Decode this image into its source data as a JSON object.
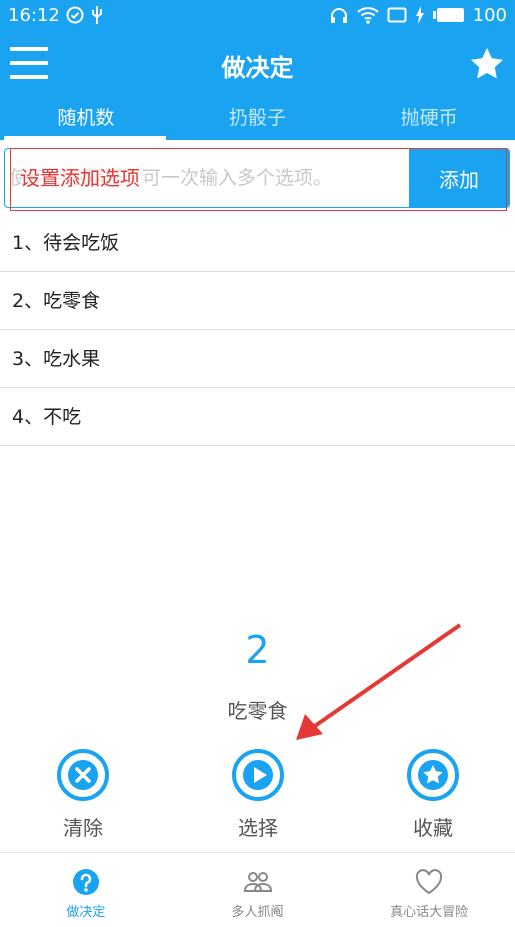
{
  "colors": {
    "accent": "#1aa3f0",
    "annotation": "#e53935"
  },
  "status_bar": {
    "time": "16:12",
    "battery": "100"
  },
  "title_bar": {
    "title": "做决定",
    "menu_icon": "menu-icon",
    "favorite_icon": "star-icon"
  },
  "tabs": [
    {
      "label": "随机数",
      "active": true
    },
    {
      "label": "扔骰子",
      "active": false
    },
    {
      "label": "抛硬币",
      "active": false
    }
  ],
  "input": {
    "placeholder": "使用空格隔开，可一次输入多个选项。",
    "add_label": "添加"
  },
  "annotation": {
    "text": "设置添加选项"
  },
  "options": [
    "1、待会吃饭",
    "2、吃零食",
    "3、吃水果",
    "4、不吃"
  ],
  "result": {
    "number": "2",
    "text": "吃零食"
  },
  "actions": {
    "clear_label": "清除",
    "select_label": "选择",
    "favorite_label": "收藏"
  },
  "bottom_nav": [
    {
      "label": "做决定",
      "icon": "question-icon",
      "active": true
    },
    {
      "label": "多人抓阄",
      "icon": "people-icon",
      "active": false
    },
    {
      "label": "真心话大冒险",
      "icon": "heart-icon",
      "active": false
    }
  ]
}
